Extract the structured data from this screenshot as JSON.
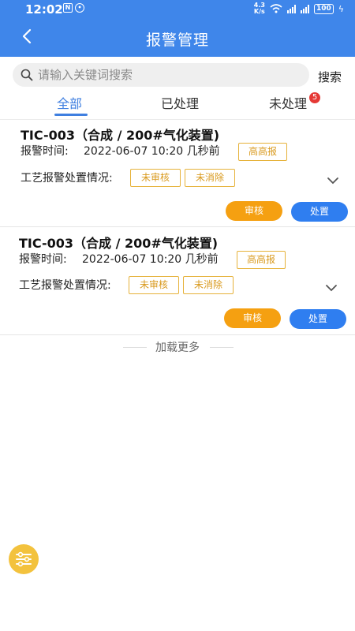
{
  "status_bar": {
    "time": "12:02",
    "speed_top": "4.3",
    "speed_bottom": "K/s",
    "battery": "100"
  },
  "header": {
    "title": "报警管理"
  },
  "search": {
    "placeholder": "请输入关键词搜索",
    "button": "搜索"
  },
  "tabs": [
    {
      "label": "全部",
      "active": true
    },
    {
      "label": "已处理"
    },
    {
      "label": "未处理",
      "badge": "5"
    }
  ],
  "alarms": [
    {
      "title": "TIC-003（合成 / 200#气化装置)",
      "time_label": "报警时间:",
      "time_value": "2022-06-07 10:20 几秒前",
      "level": "高高报",
      "process_label": "工艺报警处置情况:",
      "audit_status": "未审核",
      "clear_status": "未消除",
      "review_button": "审核",
      "handle_button": "处置"
    },
    {
      "title": "TIC-003（合成 / 200#气化装置)",
      "time_label": "报警时间:",
      "time_value": "2022-06-07 10:20 几秒前",
      "level": "高高报",
      "process_label": "工艺报警处置情况:",
      "audit_status": "未审核",
      "clear_status": "未消除",
      "review_button": "审核",
      "handle_button": "处置"
    }
  ],
  "footer": {
    "load_more": "加载更多"
  },
  "colors": {
    "primary": "#3f86ea",
    "accent": "#f5a011",
    "tag": "#e6b23a",
    "badge": "#e53935",
    "fab": "#f3c23d"
  },
  "icons": [
    "back-arrow-icon",
    "search-icon",
    "chevron-down-icon",
    "filter-sliders-icon"
  ]
}
